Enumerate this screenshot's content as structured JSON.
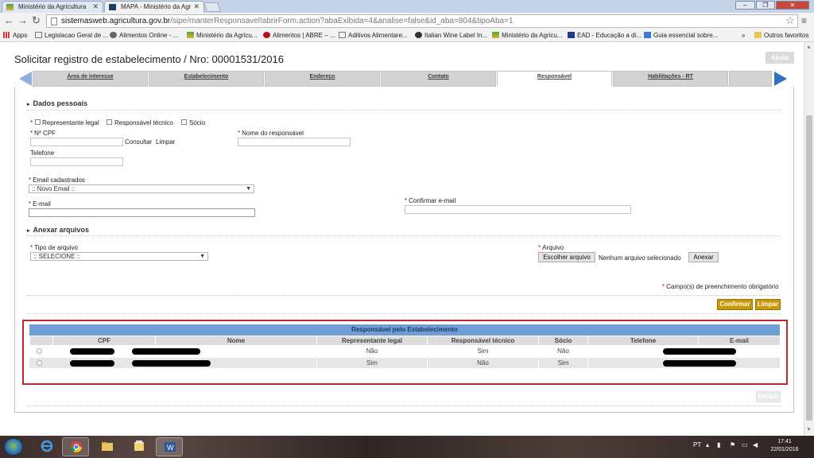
{
  "browser": {
    "tabs": [
      {
        "title": "Ministério da Agricultura"
      },
      {
        "title": "MAPA - Ministério da Agr"
      }
    ],
    "url_host": "sistemasweb.agricultura.gov.br",
    "url_path": "/sipe/manterResponsavel!abrirForm.action?abaExibida=4&analise=false&id_aba=804&tipoAba=1",
    "bookmarks": [
      {
        "label": "Apps"
      },
      {
        "label": "Legislacao Geral de ..."
      },
      {
        "label": "Alimentos Online - ..."
      },
      {
        "label": "Ministério da Agricu..."
      },
      {
        "label": "Alimentos | ABRE – ..."
      },
      {
        "label": "Aditivos Alimentare..."
      },
      {
        "label": "Italian Wine Label In..."
      },
      {
        "label": "Ministério da Agricu..."
      },
      {
        "label": "EAD - Educação a di..."
      },
      {
        "label": "Guia essencial sobre..."
      },
      {
        "label": "»"
      },
      {
        "label": "Outros favoritos"
      }
    ]
  },
  "page": {
    "title": "Solicitar registro de estabelecimento / Nro: 00001531/2016",
    "help_label": "Ajuda",
    "wizard_tabs": [
      {
        "label": "Área de interesse"
      },
      {
        "label": "Estabelecimento"
      },
      {
        "label": "Endereço"
      },
      {
        "label": "Contato"
      },
      {
        "label": "Responsável"
      },
      {
        "label": "Habilitações - RT"
      }
    ]
  },
  "personal": {
    "section_title": "Dados pessoais",
    "chk_legal": "Representante legal",
    "chk_tech": "Responsável técnico",
    "chk_partner": "Sócio",
    "cpf_label": "Nº CPF",
    "consultar": "Consultar",
    "limpar": "Limpar",
    "name_label": "Nome do responsável",
    "phone_label": "Telefone",
    "email_registered_label": "Email cadastrados",
    "email_registered_value": ":: Novo Email ::",
    "email_label": "E-mail",
    "confirm_email_label": "Confirmar e-mail"
  },
  "attachments": {
    "section_title": "Anexar arquivos",
    "file_type_label": "Tipo de arquivo",
    "file_type_value": ":: SELECIONE ::",
    "file_label": "Arquivo",
    "choose_file": "Escolher arquivo",
    "no_file": "Nenhum arquivo selecionado",
    "attach": "Anexar"
  },
  "form": {
    "required_note": "Campo(s) de preenchimento obrigatório",
    "confirm": "Confirmar",
    "clear": "Limpar",
    "delete": "Excluir"
  },
  "table": {
    "title": "Responsável pelo Estabelecimento",
    "headers": [
      "CPF",
      "Nome",
      "Representante legal",
      "Responsável técnico",
      "Sócio",
      "Telefone",
      "E-mail"
    ],
    "rows": [
      {
        "legal": "Não",
        "tech": "Sim",
        "partner": "Não",
        "phone": ""
      },
      {
        "legal": "Sim",
        "tech": "Não",
        "partner": "Sim",
        "phone": ""
      }
    ]
  },
  "taskbar": {
    "lang": "PT",
    "time": "17:41",
    "date": "22/01/2016"
  },
  "colors": {
    "accent_blue": "#6f9ed6",
    "gold_button": "#c8980a",
    "highlight_red": "#c0272d"
  }
}
